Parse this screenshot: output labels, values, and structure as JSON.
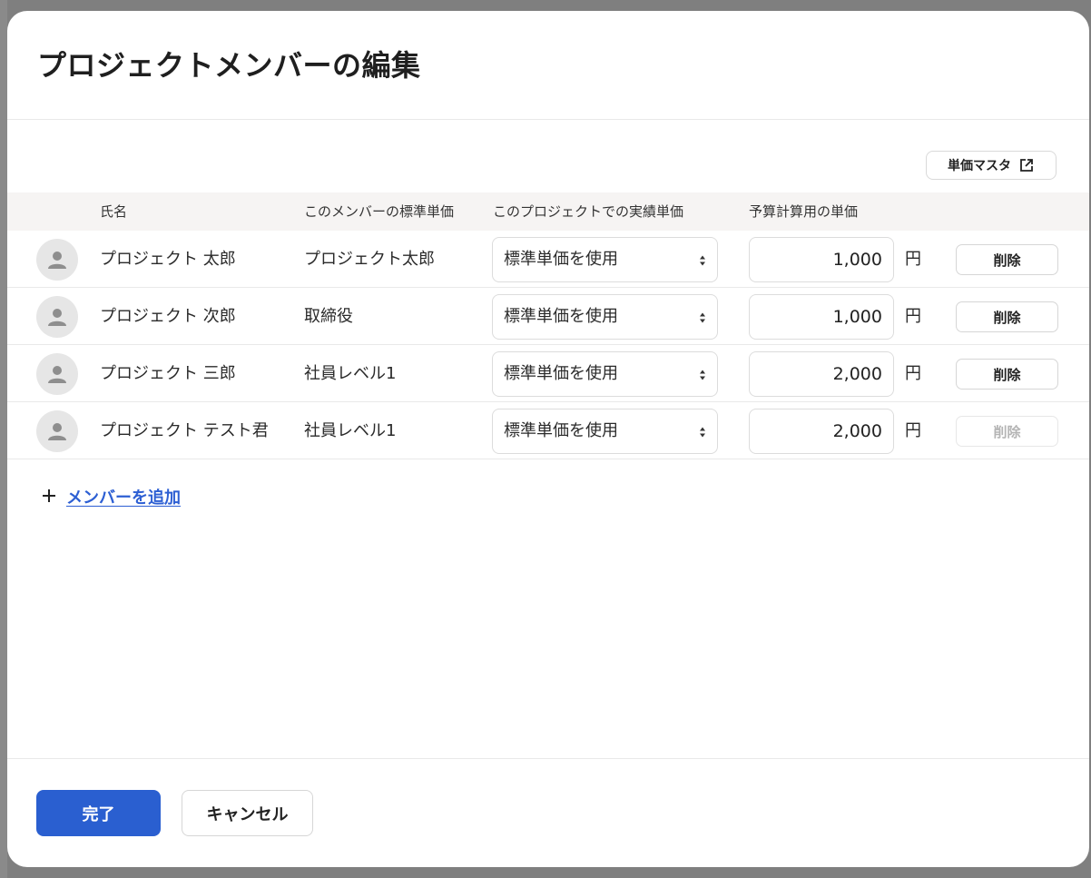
{
  "modal": {
    "title": "プロジェクトメンバーの編集",
    "master_button_label": "単価マスタ"
  },
  "table": {
    "headers": {
      "name": "氏名",
      "standard_rate": "このメンバーの標準単価",
      "actual_rate": "このプロジェクトでの実績単価",
      "budget_rate": "予算計算用の単価"
    },
    "rows": [
      {
        "name": "プロジェクト 太郎",
        "standard_rate": "プロジェクト太郎",
        "actual_rate": "標準単価を使用",
        "budget_rate": "1,000",
        "unit": "円",
        "delete_label": "削除",
        "delete_enabled": true
      },
      {
        "name": "プロジェクト 次郎",
        "standard_rate": "取締役",
        "actual_rate": "標準単価を使用",
        "budget_rate": "1,000",
        "unit": "円",
        "delete_label": "削除",
        "delete_enabled": true
      },
      {
        "name": "プロジェクト 三郎",
        "standard_rate": "社員レベル1",
        "actual_rate": "標準単価を使用",
        "budget_rate": "2,000",
        "unit": "円",
        "delete_label": "削除",
        "delete_enabled": true
      },
      {
        "name": "プロジェクト テスト君",
        "standard_rate": "社員レベル1",
        "actual_rate": "標準単価を使用",
        "budget_rate": "2,000",
        "unit": "円",
        "delete_label": "削除",
        "delete_enabled": false
      }
    ]
  },
  "add_member": {
    "icon": "plus-icon",
    "label": "メンバーを追加"
  },
  "footer": {
    "done_label": "完了",
    "cancel_label": "キャンセル"
  },
  "colors": {
    "primary": "#2a5fd0",
    "link": "#2d5fd3",
    "header_bg": "#f6f4f3"
  },
  "icons": {
    "avatar": "person-avatar-icon",
    "external": "external-link-icon",
    "select": "select-arrows-icon"
  }
}
